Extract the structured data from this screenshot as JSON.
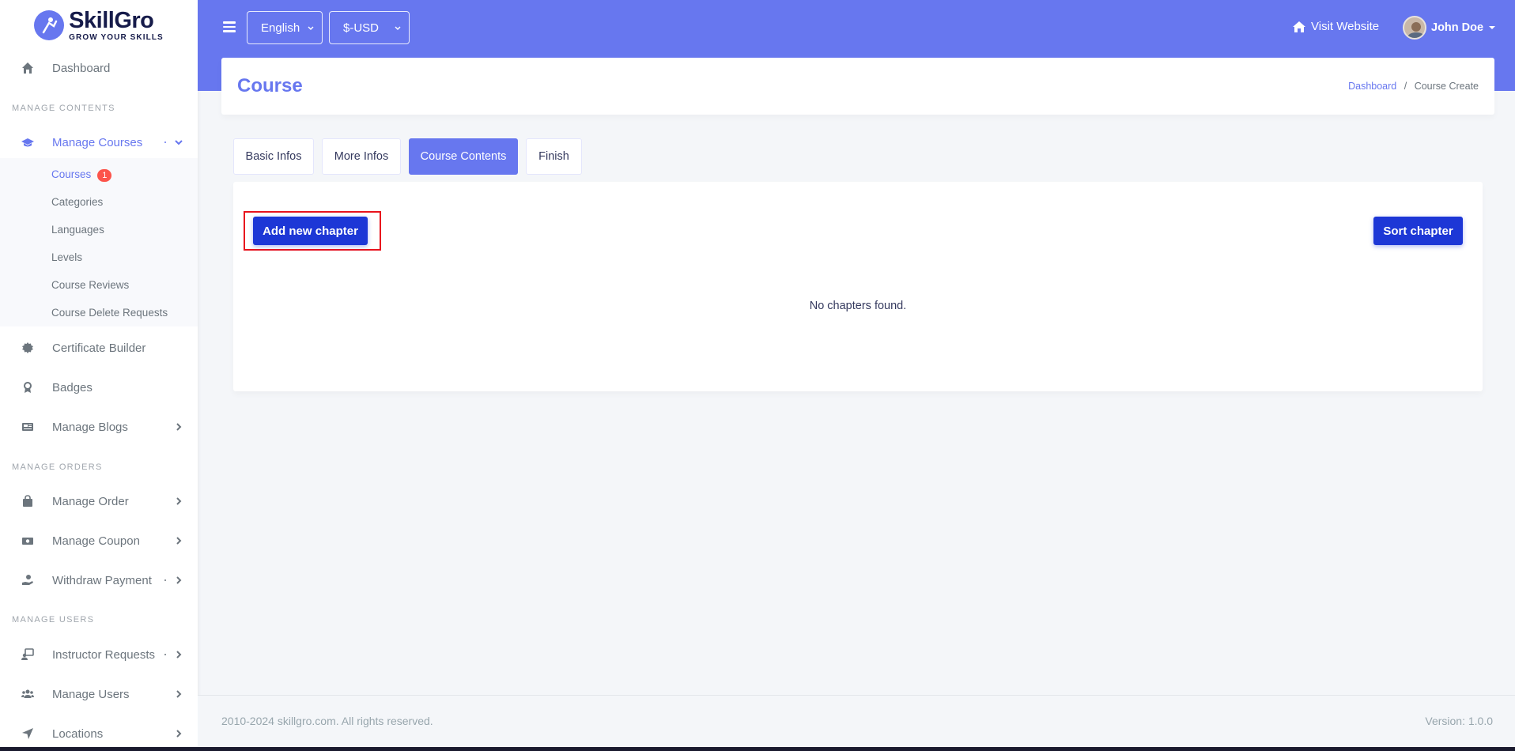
{
  "brand": {
    "name": "SkillGro",
    "tagline": "GROW YOUR SKILLS",
    "accent_color": "#6777ef",
    "primary_button_color": "#1d37d6"
  },
  "sidebar": {
    "dashboard": "Dashboard",
    "section_contents": "MANAGE CONTENTS",
    "manage_courses": "Manage Courses",
    "courses_submenu": {
      "courses": "Courses",
      "courses_badge": "1",
      "categories": "Categories",
      "languages": "Languages",
      "levels": "Levels",
      "course_reviews": "Course Reviews",
      "course_delete_requests": "Course Delete Requests"
    },
    "certificate_builder": "Certificate Builder",
    "badges": "Badges",
    "manage_blogs": "Manage Blogs",
    "section_orders": "MANAGE ORDERS",
    "manage_order": "Manage Order",
    "manage_coupon": "Manage Coupon",
    "withdraw_payment": "Withdraw Payment",
    "section_users": "MANAGE USERS",
    "instructor_requests": "Instructor Requests",
    "manage_users": "Manage Users",
    "locations": "Locations"
  },
  "topbar": {
    "language_select": "English",
    "currency_select": "$-USD",
    "visit_website": "Visit Website",
    "user_name": "John Doe"
  },
  "page": {
    "title": "Course",
    "breadcrumb_home": "Dashboard",
    "breadcrumb_separator": "/",
    "breadcrumb_current": "Course Create"
  },
  "tabs": {
    "basic_infos": "Basic Infos",
    "more_infos": "More Infos",
    "course_contents": "Course Contents",
    "finish": "Finish"
  },
  "content": {
    "add_chapter": "Add new chapter",
    "sort_chapter": "Sort chapter",
    "empty_message": "No chapters found."
  },
  "footer": {
    "copyright": "2010-2024 skillgro.com. All rights reserved.",
    "version": "Version: 1.0.0"
  }
}
